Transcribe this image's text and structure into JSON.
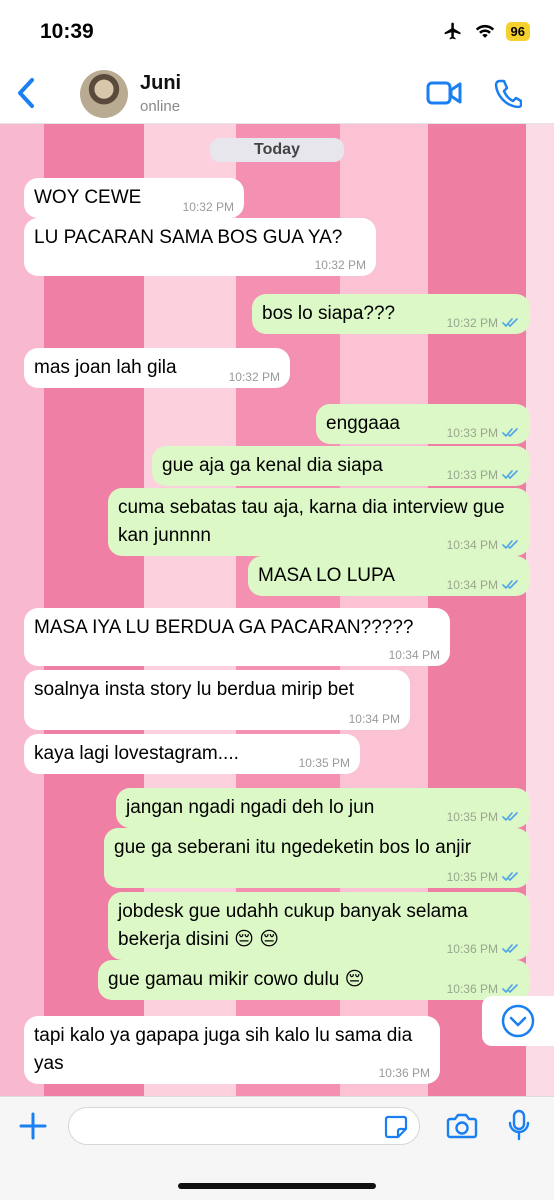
{
  "status_bar": {
    "time": "10:39",
    "battery": "96"
  },
  "header": {
    "name": "Juni",
    "status": "online"
  },
  "chat": {
    "date_label": "Today",
    "messages": [
      {
        "dir": "in",
        "text": "WOY CEWE",
        "time": "10:32 PM"
      },
      {
        "dir": "in",
        "text": "LU PACARAN SAMA BOS GUA YA?",
        "time": "10:32 PM"
      },
      {
        "dir": "out",
        "text": "bos lo siapa???",
        "time": "10:32 PM"
      },
      {
        "dir": "in",
        "text": "mas joan lah gila",
        "time": "10:32 PM"
      },
      {
        "dir": "out",
        "text": "enggaaa",
        "time": "10:33 PM"
      },
      {
        "dir": "out",
        "text": "gue aja ga kenal dia siapa",
        "time": "10:33 PM"
      },
      {
        "dir": "out",
        "text": "cuma sebatas tau aja, karna dia interview gue kan junnnn",
        "time": "10:34 PM"
      },
      {
        "dir": "out",
        "text": "MASA LO LUPA",
        "time": "10:34 PM"
      },
      {
        "dir": "in",
        "text": "MASA IYA LU BERDUA GA PACARAN?????",
        "time": "10:34 PM"
      },
      {
        "dir": "in",
        "text": "soalnya insta story lu berdua mirip bet",
        "time": "10:34 PM"
      },
      {
        "dir": "in",
        "text": "kaya lagi lovestagram....",
        "time": "10:35 PM"
      },
      {
        "dir": "out",
        "text": "jangan ngadi ngadi deh lo jun",
        "time": "10:35 PM"
      },
      {
        "dir": "out",
        "text": "gue ga seberani itu ngedeketin bos lo anjir",
        "time": "10:35 PM"
      },
      {
        "dir": "out",
        "text": "jobdesk gue udahh cukup banyak selama bekerja disini 😔 😔",
        "time": "10:36 PM"
      },
      {
        "dir": "out",
        "text": "gue gamau mikir cowo dulu 😔",
        "time": "10:36 PM"
      },
      {
        "dir": "in",
        "text": "tapi kalo ya gapapa juga sih kalo lu sama dia yas",
        "time": "10:36 PM"
      }
    ]
  },
  "colors": {
    "outgoing": "#dcf8c6",
    "incoming": "#ffffff",
    "accent": "#1a7ff0",
    "tick": "#4fa3e8"
  },
  "icons": [
    "airplane-icon",
    "wifi-icon",
    "back-chevron-icon",
    "video-camera-icon",
    "phone-icon",
    "chevron-down-icon",
    "plus-icon",
    "sticker-icon",
    "camera-icon",
    "microphone-icon"
  ]
}
